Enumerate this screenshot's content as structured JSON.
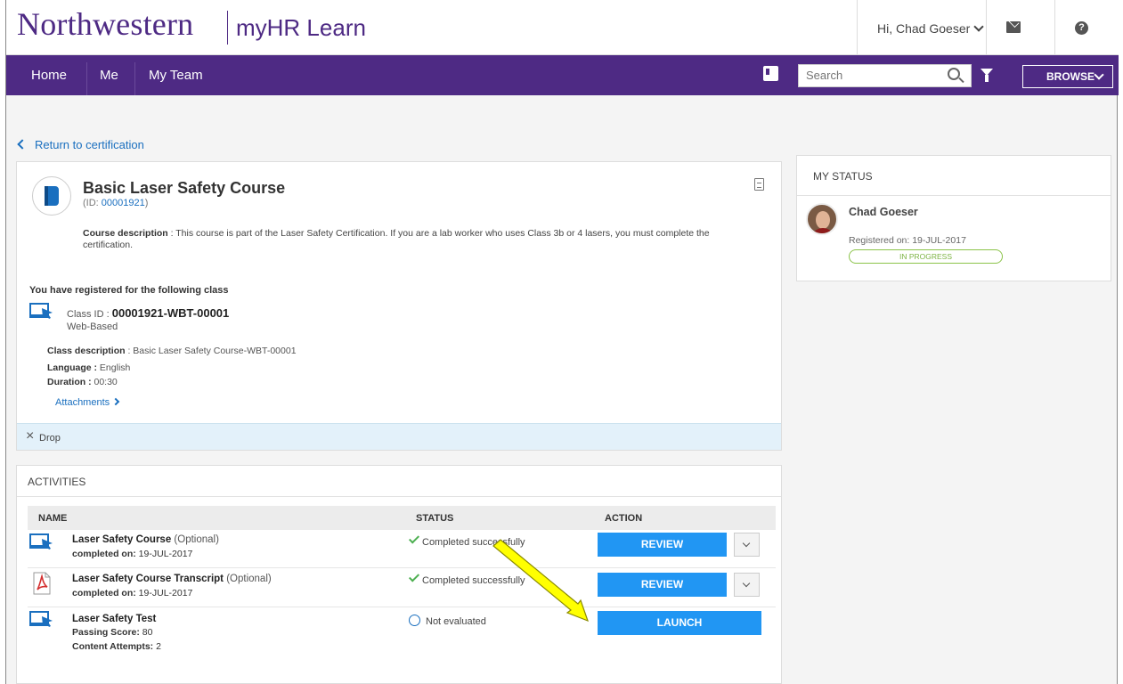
{
  "header": {
    "brand": "Northwestern",
    "app_name": "myHR Learn",
    "greeting": "Hi, Chad Goeser",
    "help_glyph": "?"
  },
  "nav": {
    "items": [
      {
        "label": "Home"
      },
      {
        "label": "Me"
      },
      {
        "label": "My Team"
      }
    ],
    "search_placeholder": "Search",
    "browse_label": "BROWSE"
  },
  "return_link": "Return to certification",
  "course": {
    "title": "Basic Laser Safety Course",
    "id_prefix": "(ID: ",
    "id": "00001921",
    "id_suffix": ")",
    "desc_label": "Course description",
    "desc_text": " : This course is part of the Laser Safety Certification. If you are a lab worker who uses Class 3b or 4 lasers, you must complete the certification.",
    "registered_heading": "You have registered for the following class",
    "class_id_label": "Class ID : ",
    "class_id": "00001921-WBT-00001",
    "class_type": "Web-Based",
    "class_desc_label": "Class description",
    "class_desc_text": " : Basic Laser Safety Course-WBT-00001",
    "language_label": "Language :",
    "language": " English",
    "duration_label": "Duration :",
    "duration": " 00:30",
    "attachments": "Attachments",
    "drop_icon": "×",
    "drop_label": "Drop"
  },
  "activities": {
    "title": "ACTIVITIES",
    "columns": {
      "name": "NAME",
      "status": "STATUS",
      "action": "ACTION"
    },
    "rows": [
      {
        "name": "Laser Safety Course",
        "optional": " (Optional)",
        "sub_label": "completed on:",
        "sub_value": " 19-JUL-2017",
        "status": "Completed successfully",
        "action": "REVIEW",
        "icon": "computer-icon"
      },
      {
        "name": "Laser Safety Course Transcript",
        "optional": " (Optional)",
        "sub_label": "completed on:",
        "sub_value": " 19-JUL-2017",
        "status": "Completed successfully",
        "action": "REVIEW",
        "icon": "pdf-icon"
      },
      {
        "name": "Laser Safety Test",
        "sub_label": "Passing Score:",
        "sub_value": " 80",
        "sub2_label": "Content Attempts:",
        "sub2_value": " 2",
        "status": "Not evaluated",
        "action": "LAUNCH",
        "icon": "computer-icon"
      }
    ]
  },
  "my_status": {
    "title": "MY STATUS",
    "name": "Chad Goeser",
    "registered": "Registered on: 19-JUL-2017",
    "badge": "IN PROGRESS"
  },
  "colors": {
    "brand_purple": "#4e2a84",
    "action_blue": "#2196f3",
    "link_blue": "#1a6fbf",
    "success_green": "#4caf50",
    "arrow_yellow": "#ffff00"
  }
}
